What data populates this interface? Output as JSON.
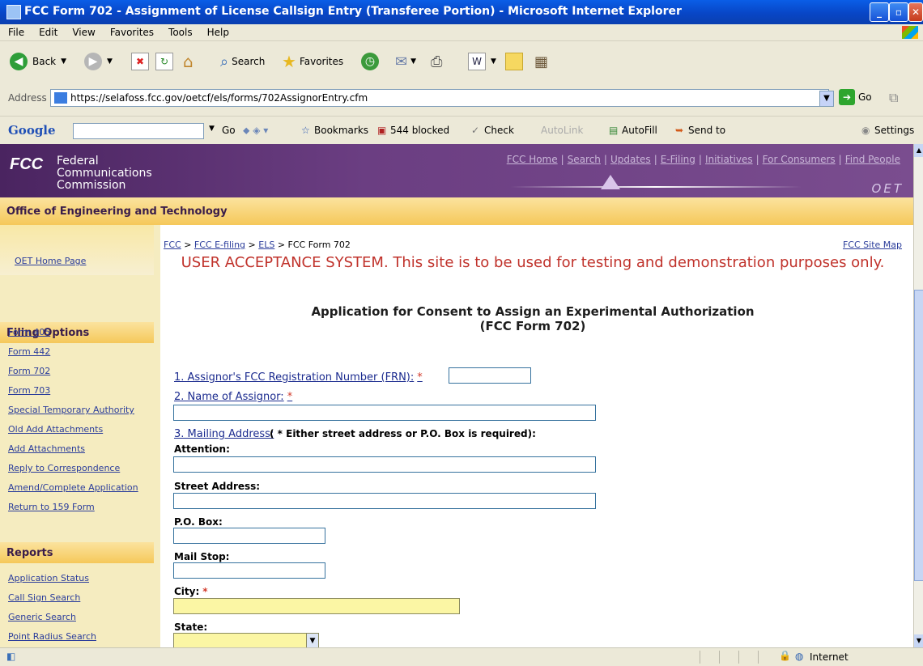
{
  "window": {
    "title": "FCC Form 702 - Assignment of License Callsign Entry (Transferee Portion) - Microsoft Internet Explorer"
  },
  "menu": [
    "File",
    "Edit",
    "View",
    "Favorites",
    "Tools",
    "Help"
  ],
  "toolbar": {
    "back": "Back",
    "search": "Search",
    "favorites": "Favorites"
  },
  "address": {
    "label": "Address",
    "url": "https://selafoss.fcc.gov/oetcf/els/forms/702AssignorEntry.cfm",
    "go": "Go"
  },
  "google": {
    "logo": "Google",
    "go": "Go",
    "bookmarks": "Bookmarks",
    "blocked": "544 blocked",
    "check": "Check",
    "autolink": "AutoLink",
    "autofill": "AutoFill",
    "sendto": "Send to",
    "settings": "Settings"
  },
  "header": {
    "org_line1": "Federal",
    "org_line2": "Communications",
    "org_line3": "Commission",
    "logo_text": "FCC",
    "badge": "OET",
    "links": [
      "FCC Home",
      "Search",
      "Updates",
      "E-Filing",
      "Initiatives",
      "For Consumers",
      "Find People"
    ],
    "office": "Office of Engineering and Technology"
  },
  "sidebar": {
    "home": "OET Home Page",
    "filing_heading": "Filing Options",
    "filing": [
      "Form 405",
      "Form 442",
      "Form 702",
      "Form 703",
      "Special Temporary Authority",
      "Old Add Attachments",
      "Add Attachments",
      "Reply to Correspondence",
      "Amend/Complete Application",
      "Return to 159 Form"
    ],
    "reports_heading": "Reports",
    "reports": [
      "Application Status",
      "Call Sign Search",
      "Generic Search",
      "Point Radius Search"
    ]
  },
  "breadcrumb": {
    "items": [
      "FCC",
      "FCC E-filing",
      "ELS"
    ],
    "current": "FCC Form 702",
    "sep": ">"
  },
  "sitemap": "FCC Site Map",
  "notice": "USER ACCEPTANCE SYSTEM. This site is to be used for testing and demonstration purposes only.",
  "form": {
    "title_line1": "Application for Consent to Assign an Experimental Authorization",
    "title_line2": "(FCC Form 702)",
    "frn_label": "1. Assignor's FCC Registration Number (FRN):",
    "name_label": "2. Name of Assignor:",
    "mailing_label": "3. Mailing Address:",
    "mailing_note": "( * Either street address or P.O. Box is required):",
    "attention": "Attention:",
    "street": "Street Address:",
    "pobox": "P.O. Box:",
    "mailstop": "Mail Stop:",
    "city": "City:",
    "state": "State:",
    "required_mark": "*"
  },
  "status": {
    "zone": "Internet"
  }
}
